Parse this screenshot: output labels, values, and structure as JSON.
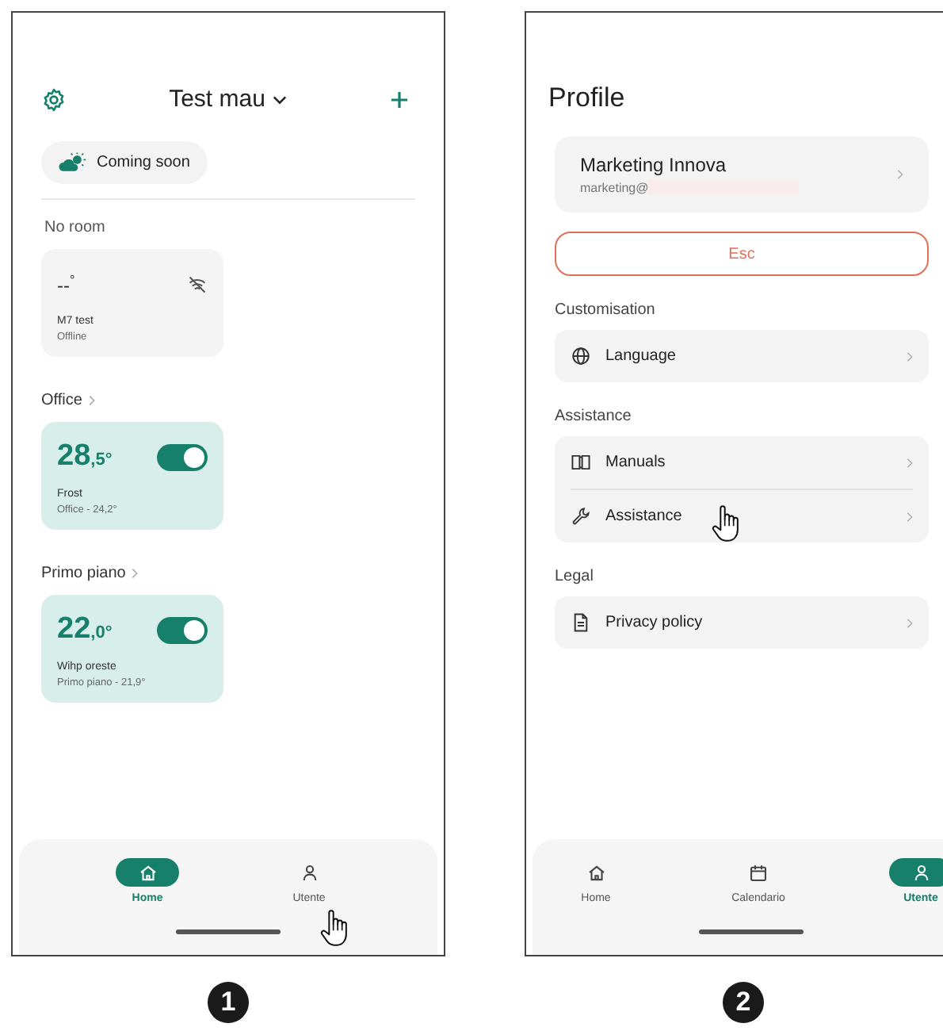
{
  "home_screen": {
    "home_name": "Test mau",
    "weather_chip": "Coming soon",
    "sections": [
      {
        "title": "No room",
        "link": false,
        "devices": [
          {
            "temp": "--",
            "decimal": "°",
            "name": "M7 test",
            "detail": "Offline",
            "online": false
          }
        ]
      },
      {
        "title": "Office",
        "link": true,
        "devices": [
          {
            "temp": "28",
            "decimal": ",5°",
            "name": "Frost",
            "detail": "Office - 24,2°",
            "online": true,
            "on": true
          }
        ]
      },
      {
        "title": "Primo piano",
        "link": true,
        "devices": [
          {
            "temp": "22",
            "decimal": ",0°",
            "name": "Wihp oreste",
            "detail": "Primo piano - 21,9°",
            "online": true,
            "on": true
          }
        ]
      }
    ],
    "nav": [
      {
        "kind": "home",
        "label": "Home",
        "selected": true
      },
      {
        "kind": "user",
        "label": "Utente",
        "selected": false
      }
    ]
  },
  "profile_screen": {
    "title": "Profile",
    "account": {
      "name": "Marketing Innova",
      "email": "marketing@",
      "redacted": true
    },
    "logout_button": "Esc",
    "groups": [
      {
        "title": "Customisation",
        "items": [
          {
            "kind": "globe",
            "label": "Language"
          }
        ]
      },
      {
        "title": "Assistance",
        "items": [
          {
            "kind": "book",
            "label": "Manuals"
          },
          {
            "kind": "wrench",
            "label": "Assistance"
          }
        ]
      },
      {
        "title": "Legal",
        "items": [
          {
            "kind": "document",
            "label": "Privacy policy"
          }
        ]
      }
    ],
    "nav": [
      {
        "kind": "home",
        "label": "Home",
        "selected": false
      },
      {
        "kind": "calendar",
        "label": "Calendario",
        "selected": false
      },
      {
        "kind": "user",
        "label": "Utente",
        "selected": true
      }
    ]
  },
  "callouts": [
    "1",
    "2"
  ]
}
